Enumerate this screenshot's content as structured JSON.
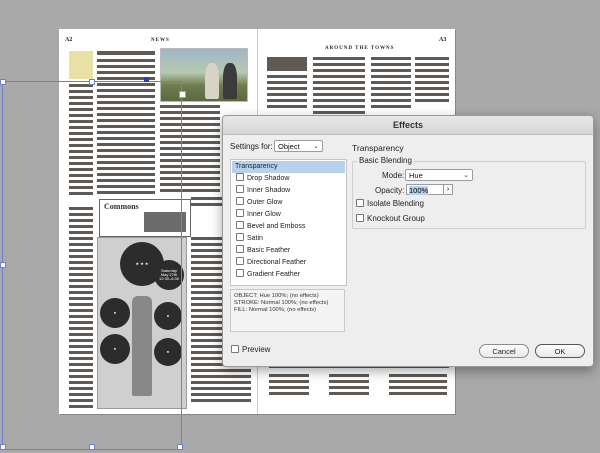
{
  "newspaper": {
    "left_folio": "A2",
    "left_section": "NEWS",
    "right_section": "AROUND THE TOWNS",
    "right_folio": "A3",
    "brand": "Commons",
    "ad_date": "May 27th",
    "ad_time": "12:30–6:30",
    "ad_day": "Saturday"
  },
  "dialog": {
    "title": "Effects",
    "settings_for_label": "Settings for:",
    "settings_for_value": "Object",
    "section_title": "Transparency",
    "list": [
      {
        "label": "Transparency",
        "checkbox": false,
        "selected": true
      },
      {
        "label": "Drop Shadow",
        "checkbox": true
      },
      {
        "label": "Inner Shadow",
        "checkbox": true
      },
      {
        "label": "Outer Glow",
        "checkbox": true
      },
      {
        "label": "Inner Glow",
        "checkbox": true
      },
      {
        "label": "Bevel and Emboss",
        "checkbox": true
      },
      {
        "label": "Satin",
        "checkbox": true
      },
      {
        "label": "Basic Feather",
        "checkbox": true
      },
      {
        "label": "Directional Feather",
        "checkbox": true
      },
      {
        "label": "Gradient Feather",
        "checkbox": true
      }
    ],
    "summary": {
      "line1": "OBJECT: Hue 100%; (no effects)",
      "line2": "STROKE: Normal 100%; (no effects)",
      "line3": "FILL: Normal 100%; (no effects)"
    },
    "basic_blending": "Basic Blending",
    "mode_label": "Mode:",
    "mode_value": "Hue",
    "opacity_label": "Opacity:",
    "opacity_value": "100%",
    "opacity_step": "›",
    "isolate_label": "Isolate Blending",
    "knockout_label": "Knockout Group",
    "preview_label": "Preview",
    "cancel_label": "Cancel",
    "ok_label": "OK"
  },
  "colors": {
    "selection": "#6e7fd1",
    "list_highlight": "#b7d1ee",
    "redaction": "#5f5a55"
  }
}
